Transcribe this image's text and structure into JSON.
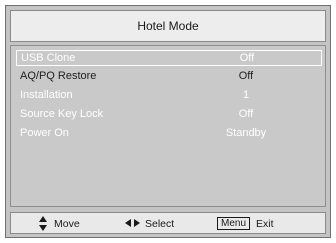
{
  "title": "Hotel Mode",
  "menu": {
    "items": [
      {
        "label": "USB Clone",
        "value": "Off"
      },
      {
        "label": "AQ/PQ Restore",
        "value": "Off"
      },
      {
        "label": "Installation",
        "value": "1"
      },
      {
        "label": "Source Key Lock",
        "value": "Off"
      },
      {
        "label": "Power On",
        "value": "Standby"
      }
    ]
  },
  "footer": {
    "move_label": "Move",
    "select_label": "Select",
    "menu_key_label": "Menu",
    "exit_label": "Exit"
  },
  "colors": {
    "panel_background": "#c4c4c4",
    "title_background": "#ededed",
    "selected_text": "#ffffff",
    "normal_text": "#1e1e1e"
  },
  "icons": {
    "move": "up-down-arrows-icon",
    "select": "left-right-arrows-icon"
  }
}
